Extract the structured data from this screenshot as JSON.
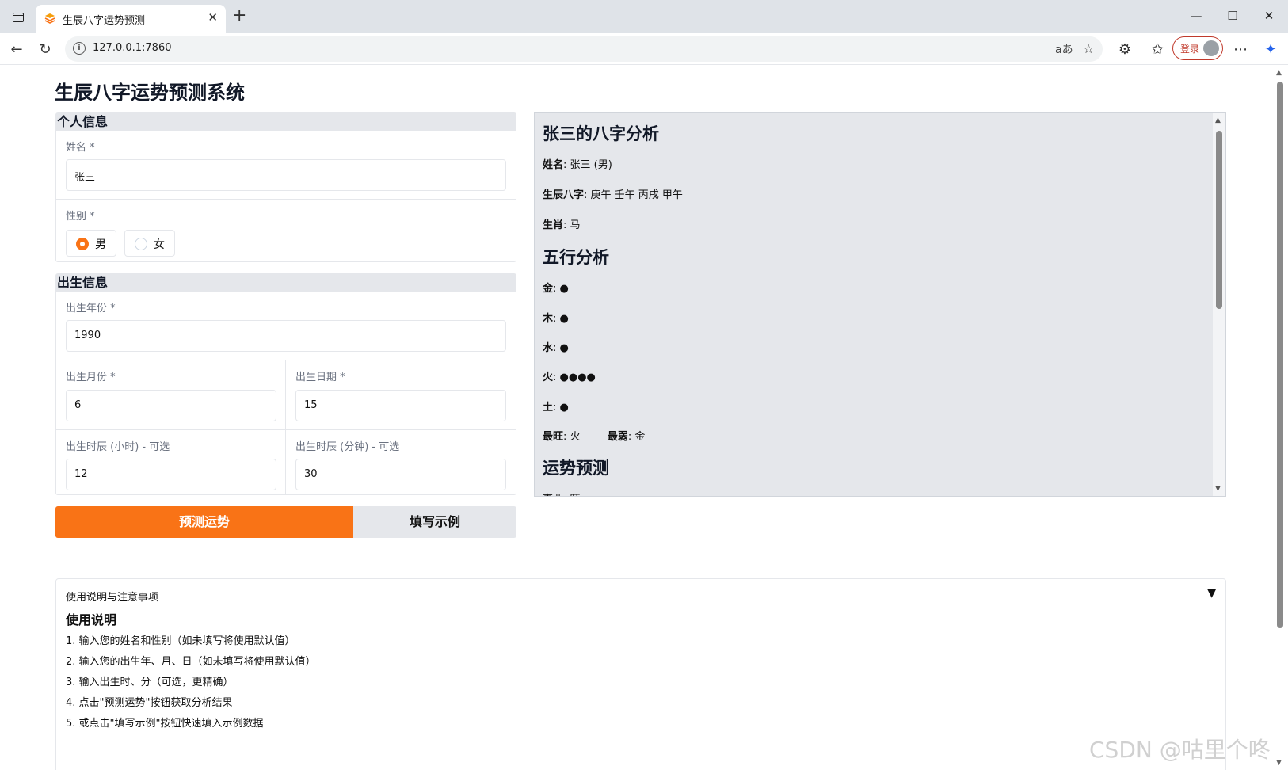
{
  "browser": {
    "tab_title": "生辰八字运势预测",
    "url": "127.0.0.1:7860",
    "read_aloud": "aあ",
    "login_label": "登录"
  },
  "app": {
    "title": "生辰八字运势预测系统"
  },
  "personal": {
    "heading": "个人信息",
    "name_label": "姓名 *",
    "name_value": "张三",
    "gender_label": "性别 *",
    "gender_options": [
      "男",
      "女"
    ],
    "gender_selected": "男"
  },
  "birth": {
    "heading": "出生信息",
    "year_label": "出生年份 *",
    "year_value": "1990",
    "month_label": "出生月份 *",
    "month_value": "6",
    "day_label": "出生日期 *",
    "day_value": "15",
    "hour_label": "出生时辰 (小时) - 可选",
    "hour_value": "12",
    "minute_label": "出生时辰 (分钟) - 可选",
    "minute_value": "30"
  },
  "actions": {
    "predict": "预测运势",
    "example": "填写示例"
  },
  "result": {
    "title": "张三的八字分析",
    "name_key": "姓名",
    "name_val": ": 张三 (男)",
    "bazi_key": "生辰八字",
    "bazi_val": ": 庚午 壬午 丙戌 甲午",
    "zodiac_key": "生肖",
    "zodiac_val": ": 马",
    "wuxing_title": "五行分析",
    "wuxing": [
      {
        "key": "金",
        "val": ": ●"
      },
      {
        "key": "木",
        "val": ": ●"
      },
      {
        "key": "水",
        "val": ": ●"
      },
      {
        "key": "火",
        "val": ": ●●●●"
      },
      {
        "key": "土",
        "val": ": ●"
      }
    ],
    "strongest_key": "最旺",
    "strongest_val": ": 火",
    "weakest_key": "最弱",
    "weakest_val": ": 金",
    "fortune_title": "运势预测",
    "cut_line": "事业: 旺"
  },
  "instructions": {
    "accordion_title": "使用说明与注意事项",
    "heading": "使用说明",
    "items": [
      "1. 输入您的姓名和性别（如未填写将使用默认值）",
      "2. 输入您的出生年、月、日（如未填写将使用默认值）",
      "3. 输入出生时、分（可选，更精确）",
      "4. 点击\"预测运势\"按钮获取分析结果",
      "5. 或点击\"填写示例\"按钮快速填入示例数据"
    ]
  },
  "watermark": "CSDN @咕里个咚",
  "colors": {
    "accent": "#f97316",
    "panel_bg": "#e5e7eb"
  }
}
